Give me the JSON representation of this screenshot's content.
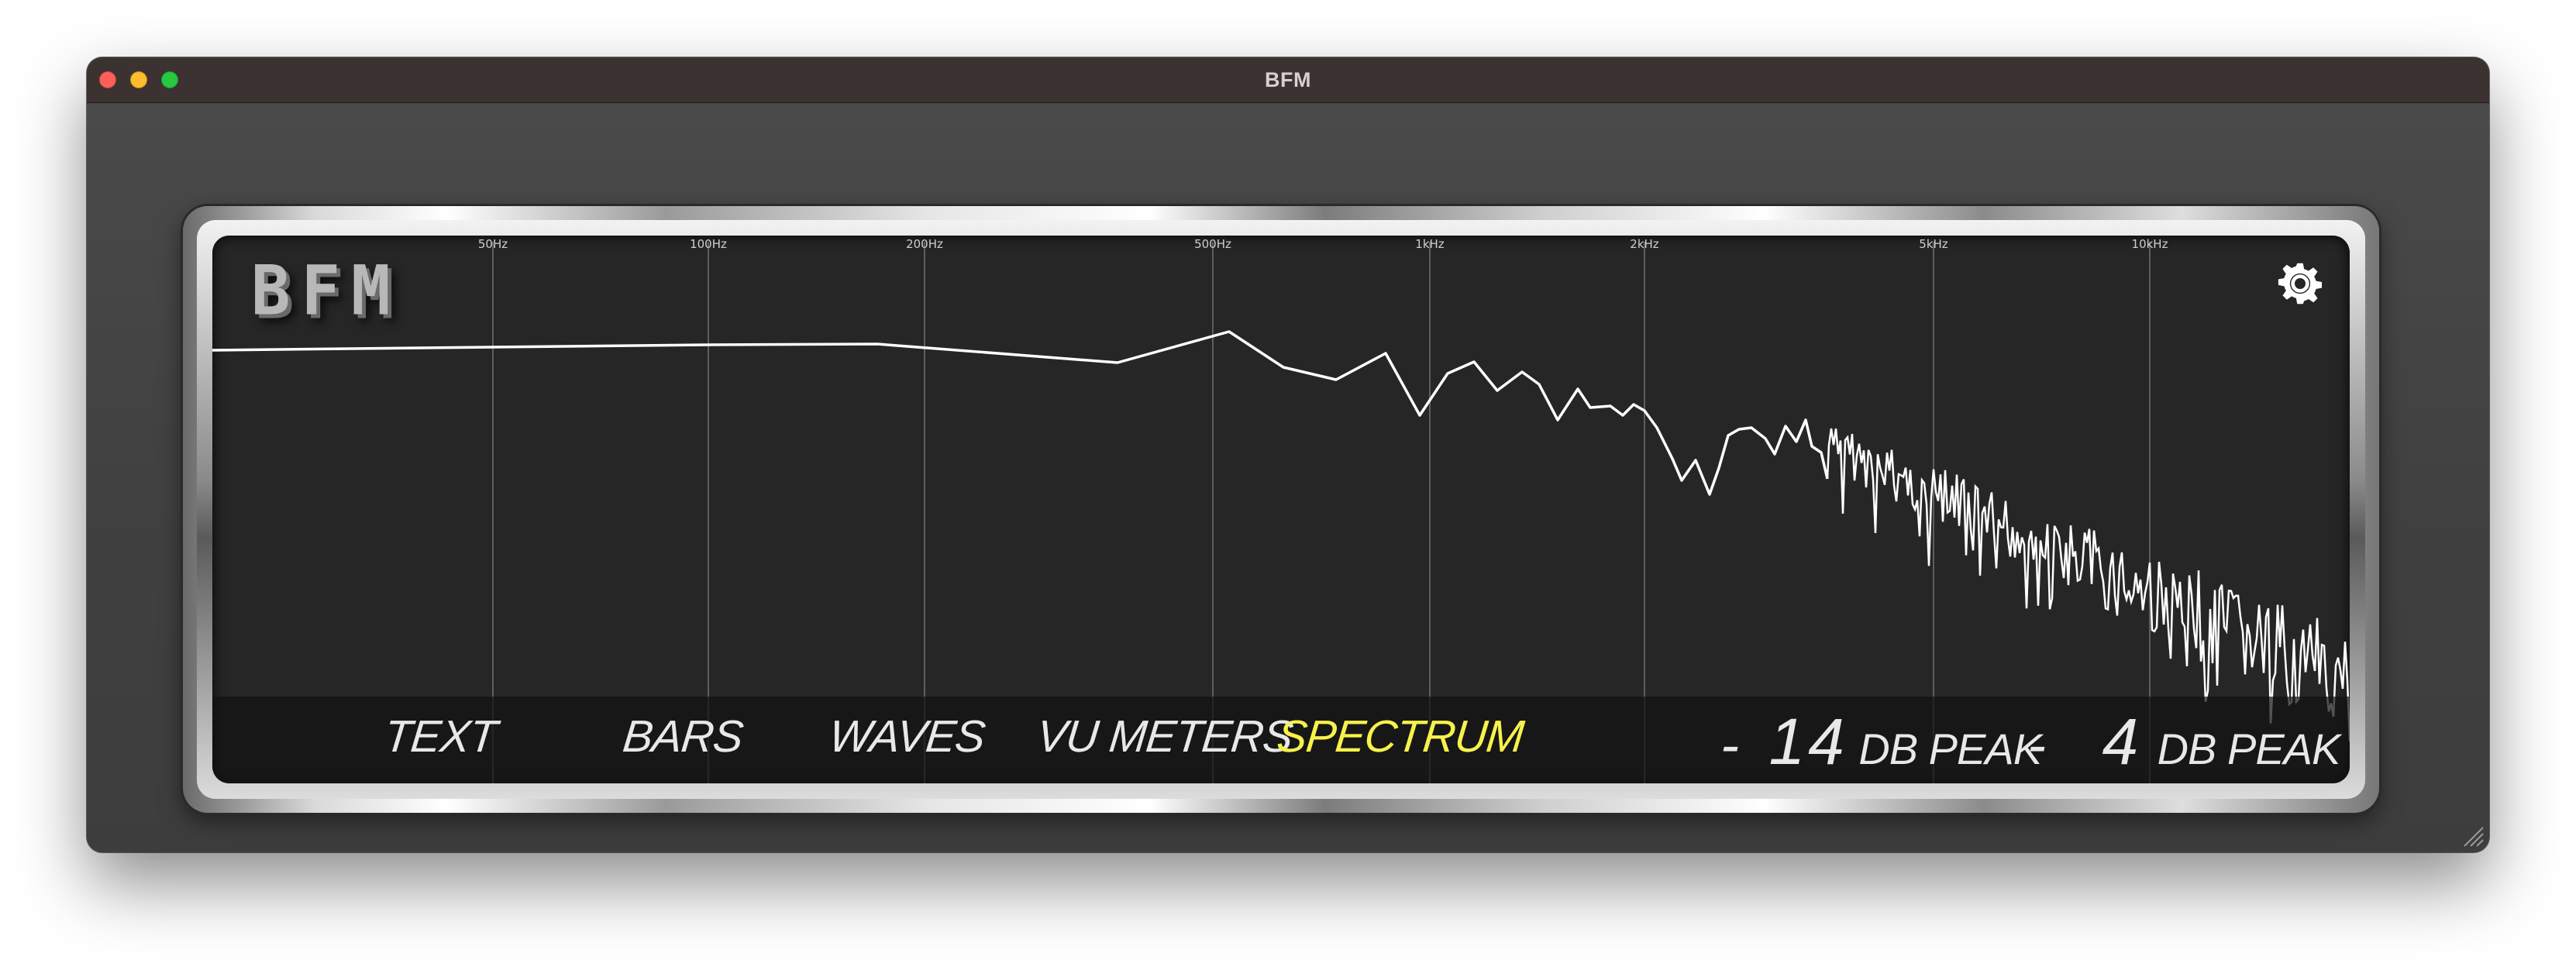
{
  "window": {
    "title": "BFM"
  },
  "logo": {
    "text": "BFM"
  },
  "frequency_labels": [
    "50Hz",
    "100Hz",
    "200Hz",
    "500Hz",
    "1kHz",
    "2kHz",
    "5kHz",
    "10kHz"
  ],
  "modes": {
    "text": "TEXT",
    "bars": "BARS",
    "waves": "WAVES",
    "vu_meters": "VU METERS",
    "spectrum": "SPECTRUM",
    "active": "SPECTRUM"
  },
  "meters": {
    "peak_sign": "-",
    "peak_value": "14",
    "peak_unit": "DB PEAK",
    "hold_sign": "-",
    "hold_value": "4",
    "hold_unit": "DB PEAK HOLD"
  },
  "colors": {
    "active_mode": "#f7f24a",
    "trace": "#ffffff",
    "display_bg": "#262626"
  },
  "icons": {
    "settings": "gear-icon",
    "resize": "resize-grip-icon"
  }
}
